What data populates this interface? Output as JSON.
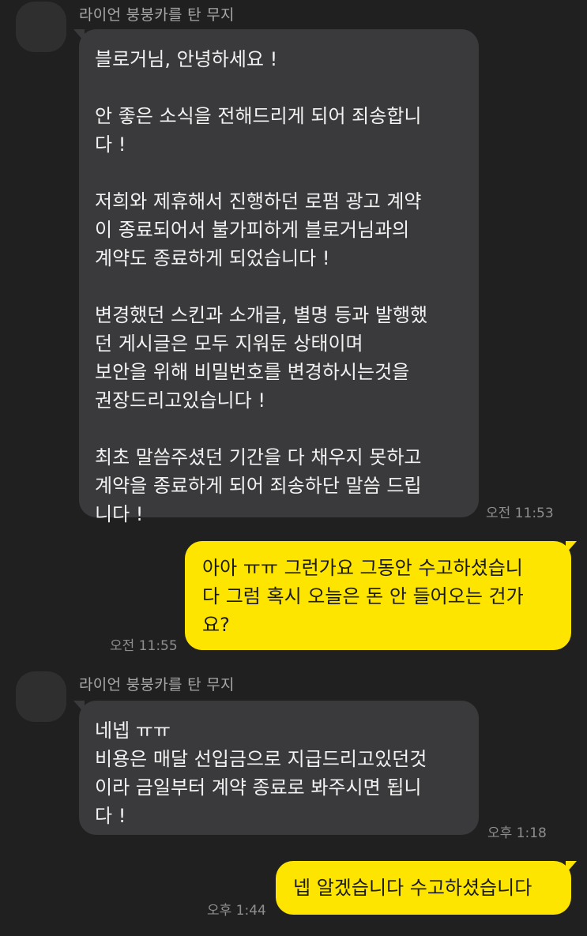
{
  "messages": [
    {
      "sender": "라이언 붕붕카를 탄 무지",
      "direction": "incoming",
      "text": "블로거님, 안녕하세요 !\n\n안 좋은 소식을 전해드리게 되어 죄송합니\n다 !\n\n저희와 제휴해서 진행하던 로펌 광고 계약\n이 종료되어서 불가피하게 블로거님과의\n계약도 종료하게 되었습니다 !\n\n변경했던 스킨과 소개글, 별명 등과 발행했\n던 게시글은 모두 지워둔 상태이며\n보안을 위해 비밀번호를 변경하시는것을\n권장드리고있습니다 !\n\n최초 말씀주셨던 기간을 다 채우지 못하고\n계약을 종료하게 되어 죄송하단 말씀 드립\n니다 !",
      "time": "오전 11:53"
    },
    {
      "direction": "outgoing",
      "text": "아아 ㅠㅠ 그런가요 그동안 수고하셨습니\n다 그럼 혹시 오늘은 돈 안 들어오는 건가\n요?",
      "time": "오전 11:55"
    },
    {
      "sender": "라이언 붕붕카를 탄 무지",
      "direction": "incoming",
      "text": "네넵 ㅠㅠ\n비용은 매달 선입금으로 지급드리고있던것\n이라 금일부터 계약 종료로 봐주시면 됩니\n다 !",
      "time": "오후 1:18"
    },
    {
      "direction": "outgoing",
      "text": "넵 알겠습니다 수고하셨습니다",
      "time": "오후 1:44"
    }
  ],
  "colors": {
    "background": "#202020",
    "incoming_bubble": "#3a3a3c",
    "outgoing_bubble": "#fee500",
    "sender_text": "#a8a8a8",
    "time_text": "#8e8e8e"
  }
}
